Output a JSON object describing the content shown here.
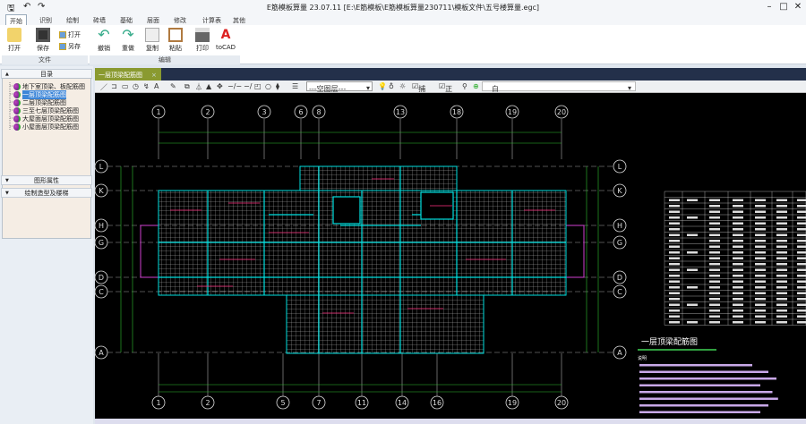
{
  "app": {
    "title": "E筋模板算量 23.07.11   [E:\\E筋模板\\E筋模板算量230711\\模板文件\\五号楼算量.egc]",
    "minimize": "–",
    "maximize": "□",
    "close": "✕"
  },
  "ribbon_tabs": [
    "开始",
    "识别",
    "绘制",
    "砖墙",
    "基础",
    "层面",
    "修改",
    "计算表",
    "其他"
  ],
  "ribbon": {
    "open": "打开",
    "save": "保存",
    "open2": "打开",
    "saveas": "另存",
    "file_group": "文件",
    "undo": "撤销",
    "redo": "重做",
    "copy": "复制",
    "paste": "粘贴",
    "print": "打印",
    "tocad": "toCAD",
    "edit_group": "编辑"
  },
  "left": {
    "catalog": "目录",
    "tree": [
      "地下室顶梁、板配筋图",
      "一层顶梁配筋图",
      "二层顶梁配筋图",
      "三至七层顶梁配筋图",
      "大屋面层顶梁配筋图",
      "小屋面层顶梁配筋图"
    ],
    "selected": 1,
    "prop": "图形属性",
    "draw": "绘制造型及楼梯"
  },
  "doc_tab": {
    "label": "一层顶梁配筋图",
    "close": "×"
  },
  "cad_toolbar": {
    "layer": "---空图层---",
    "snap": "捕捉",
    "ortho": "正交",
    "color": "白"
  },
  "drawing": {
    "title": "一层顶梁配筋图",
    "notes_title": "说明",
    "top_axes": [
      [
        "1",
        177
      ],
      [
        "2",
        232
      ],
      [
        "3",
        295
      ],
      [
        "6",
        336
      ],
      [
        "8",
        356
      ],
      [
        "13",
        447
      ],
      [
        "18",
        510
      ],
      [
        "19",
        572
      ],
      [
        "20",
        627
      ]
    ],
    "bottom_axes": [
      [
        "1",
        177
      ],
      [
        "2",
        232
      ],
      [
        "5",
        316
      ],
      [
        "7",
        356
      ],
      [
        "11",
        404
      ],
      [
        "14",
        449
      ],
      [
        "16",
        488
      ],
      [
        "19",
        572
      ],
      [
        "20",
        627
      ]
    ],
    "row_axes": [
      [
        "L",
        186
      ],
      [
        "K",
        213
      ],
      [
        "H",
        252
      ],
      [
        "G",
        271
      ],
      [
        "D",
        310
      ],
      [
        "C",
        326
      ],
      [
        "A",
        394
      ]
    ]
  },
  "colors": {
    "canvas": "#000000",
    "beam": "#00e0e0",
    "dim": "#30c030",
    "rebar": "#ff3080",
    "hatch": "#cfcfcf"
  }
}
